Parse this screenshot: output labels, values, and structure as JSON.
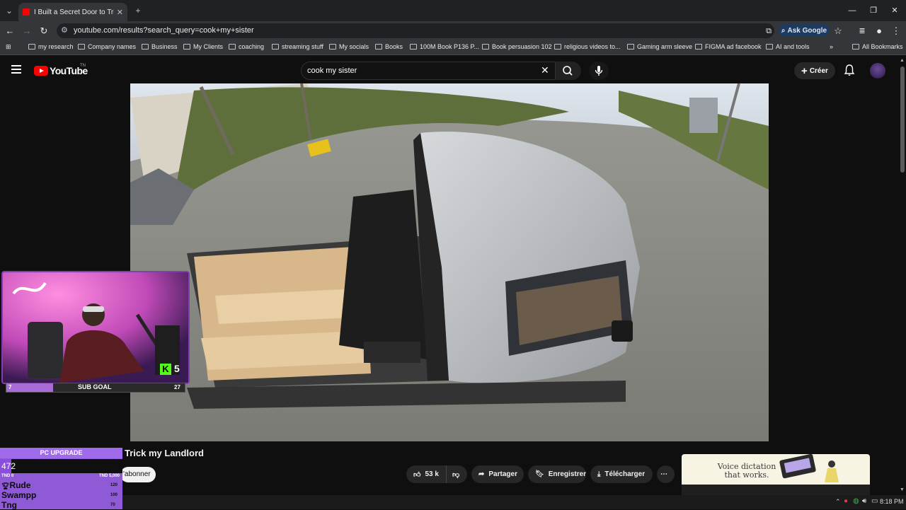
{
  "browser": {
    "tab_title": "I Built a Secret Door to Trick my",
    "url": "youtube.com/results?search_query=cook+my+sister",
    "ask_google": "Ask Google",
    "bookmarks": [
      "my research",
      "Company names",
      "Business",
      "My Clients",
      "coaching",
      "streaming stuff",
      "My socials",
      "Books",
      "100M Book P136 P...",
      "Book persuasion 102",
      "religious videos to...",
      "Gaming arm sleeve",
      "FIGMA ad facebook",
      "AI and tools"
    ],
    "all_bookmarks": "All Bookmarks"
  },
  "youtube": {
    "logo_text": "YouTube",
    "logo_tm": "TN",
    "search_value": "cook my sister",
    "create_label": "Créer",
    "video_title": "Trick my Landlord",
    "subscribe_label": "'abonner",
    "likes": "53 k",
    "share_label": "Partager",
    "save_label": "Enregistrer",
    "download_label": "Télécharger",
    "ad_text": "Voice dictation that works."
  },
  "overlays": {
    "sub_goal": {
      "current": "7",
      "label": "SUB GOAL",
      "target": "27",
      "progress": 0.26
    },
    "pc_upgrade": {
      "title": "PC UPGRADE",
      "amount": "472",
      "min": "TND 0",
      "max": "TND 5,000",
      "progress": 0.094,
      "leaderboard": [
        {
          "name": "Rude",
          "value": "120"
        },
        {
          "name": "Swampp",
          "value": "100"
        },
        {
          "name": "Tng",
          "value": "70"
        }
      ]
    },
    "webcam_badge": "5"
  },
  "taskbar": {
    "clock": "8:18 PM"
  },
  "colors": {
    "youtube_red": "#ff0000",
    "overlay_purple": "#8f5ad6",
    "chrome_dark": "#202124"
  }
}
